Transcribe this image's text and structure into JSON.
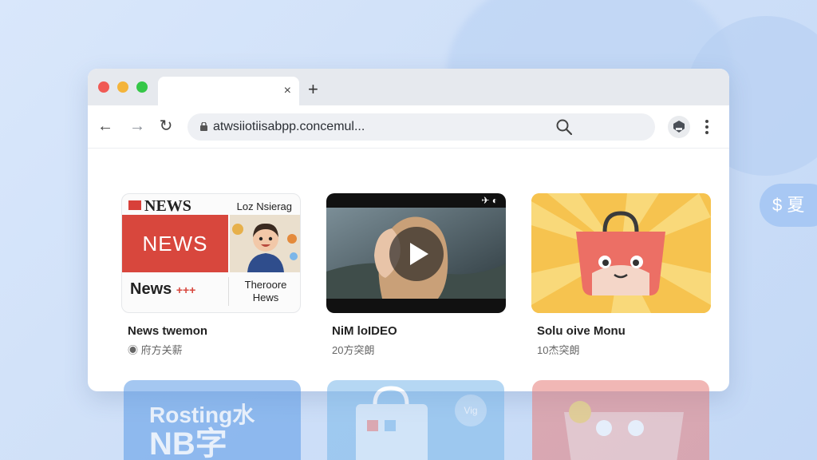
{
  "browser": {
    "tab": {
      "close_label": "×"
    },
    "new_tab_label": "+",
    "nav": {
      "back": "←",
      "forward": "→",
      "reload": "↻"
    },
    "address": "atwsiiotiisabpp.concemul...",
    "menu_icon": "kebab-icon"
  },
  "cards": [
    {
      "title": "News twemon",
      "meta": "◉ 府方关薪",
      "thumb": {
        "logo": "NEWS",
        "top_right": "Loz Nsierag",
        "banner": "NEWS",
        "bottom_left": "News",
        "bottom_plus": "+++",
        "bottom_right_1": "Theroore",
        "bottom_right_2": "Hews"
      }
    },
    {
      "title": "NiM loIDEO",
      "meta": "20方突朗",
      "thumb": {
        "icons": "✈ ◐"
      }
    },
    {
      "title": "Solu oive Monu",
      "meta": "10杰突朗"
    }
  ],
  "side_pill": "$ 夏",
  "reflections": {
    "left_line_1": "Rosting水",
    "left_line_2": "NB字",
    "middle_badge": "Vig"
  },
  "colors": {
    "background": "#cfe0f8",
    "news_red": "#d8473d",
    "shop_yellow": "#f5c24d",
    "bag_pink": "#ec6f65"
  }
}
